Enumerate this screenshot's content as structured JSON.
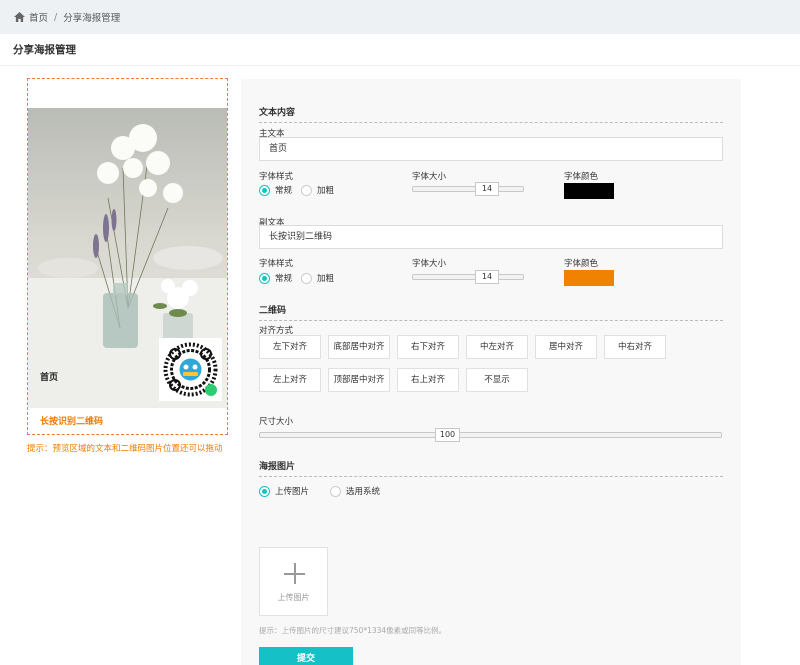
{
  "breadcrumb": {
    "home": "首页",
    "current": "分享海报管理"
  },
  "page_title": "分享海报管理",
  "preview": {
    "main_text": "首页",
    "sub_text": "长按识别二维码",
    "tip": "提示：预览区域的文本和二维码图片位置还可以拖动"
  },
  "text_section": {
    "heading": "文本内容",
    "main": {
      "label": "主文本",
      "value": "首页",
      "style_label": "字体样式",
      "style_options": [
        "常规",
        "加粗"
      ],
      "style_selected": "常规",
      "size_label": "字体大小",
      "size_value": "14",
      "size_fraction": 0.7,
      "color_label": "字体颜色",
      "color": "#000000"
    },
    "sub": {
      "label": "副文本",
      "value": "长按识别二维码",
      "style_label": "字体样式",
      "style_options": [
        "常规",
        "加粗"
      ],
      "style_selected": "常规",
      "size_label": "字体大小",
      "size_value": "14",
      "size_fraction": 0.7,
      "color_label": "字体颜色",
      "color": "#f08200"
    }
  },
  "qr_section": {
    "heading": "二维码",
    "align_label": "对齐方式",
    "align_row1": [
      "左下对齐",
      "底部居中对齐",
      "右下对齐",
      "中左对齐",
      "居中对齐",
      "中右对齐"
    ],
    "align_row2": [
      "左上对齐",
      "顶部居中对齐",
      "右上对齐",
      "不显示"
    ],
    "size_label": "尺寸大小",
    "size_value": "100",
    "size_fraction": 0.4
  },
  "poster_section": {
    "heading": "海报图片",
    "options": [
      "上传图片",
      "选用系统"
    ],
    "selected": "上传图片",
    "upload_label": "上传图片",
    "hint": "提示：上传图片的尺寸建议750*1334像素或同等比例。",
    "submit": "提交"
  },
  "colors": {
    "accent": "#16c0c7",
    "orange": "#f07a00"
  }
}
